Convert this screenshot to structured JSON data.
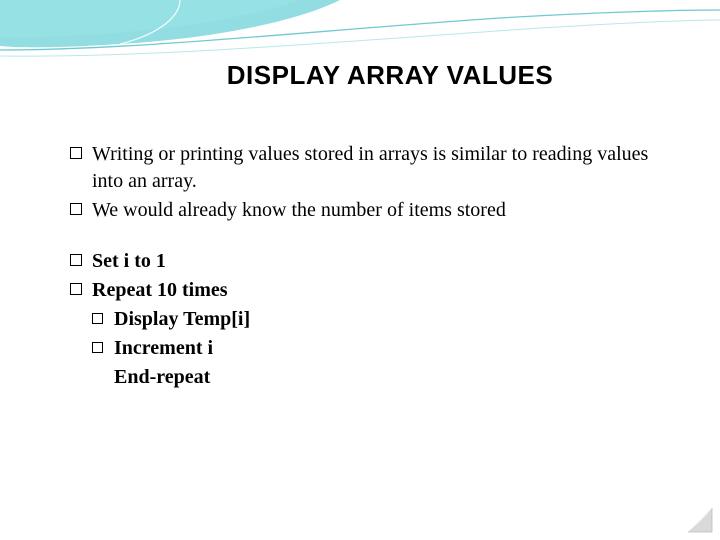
{
  "title": "DISPLAY ARRAY VALUES",
  "para": {
    "p1": "Writing or printing values stored in arrays is similar to reading values into an array.",
    "p2": "We would already know the number of items stored"
  },
  "code": {
    "l1": "Set i to 1",
    "l2": "Repeat 10 times",
    "l3": "Display Temp[i]",
    "l4": "Increment i",
    "l5": "End-repeat"
  },
  "colors": {
    "swoosh_fill": "#7fd7dc",
    "swoosh_line": "#6fc9cf"
  }
}
